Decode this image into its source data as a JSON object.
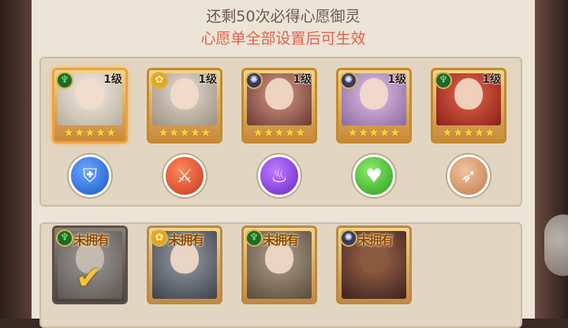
{
  "header": {
    "line1": "还剩50次必得心愿御灵",
    "line2": "心愿单全部设置后可生效"
  },
  "wishlist": [
    {
      "level": "1级",
      "element": "dragon-icon",
      "stars": "★★★★★",
      "portrait": "white",
      "selected": true
    },
    {
      "level": "1级",
      "element": "sun-icon",
      "stars": "★★★★★",
      "portrait": "grey"
    },
    {
      "level": "1级",
      "element": "web-icon",
      "stars": "★★★★★",
      "portrait": "pink"
    },
    {
      "level": "1级",
      "element": "web-icon",
      "stars": "★★★★★",
      "portrait": "lilac"
    },
    {
      "level": "1级",
      "element": "dragon-icon",
      "stars": "★★★★★",
      "portrait": "red"
    }
  ],
  "roles": [
    {
      "icon": "shield-icon",
      "glyph": "⛨",
      "color": "#1b56c8"
    },
    {
      "icon": "sword-icon",
      "glyph": "⚔",
      "color": "#c8361e"
    },
    {
      "icon": "fire-icon",
      "glyph": "♨",
      "color": "#6a26c8"
    },
    {
      "icon": "heal-icon",
      "glyph": "♥",
      "color": "#2b9a1e"
    },
    {
      "icon": "arrow-icon",
      "glyph": "➶",
      "color": "#c07a4a"
    }
  ],
  "candidates": [
    {
      "status": "未拥有",
      "element": "dragon-icon",
      "portrait": "gray2",
      "checked": true
    },
    {
      "status": "未拥有",
      "element": "sun-icon",
      "portrait": "dark"
    },
    {
      "status": "未拥有",
      "element": "dragon-icon",
      "portrait": "brown"
    },
    {
      "status": "未拥有",
      "element": "web-icon",
      "portrait": "bull"
    }
  ],
  "colors": {
    "accent_red": "#e0634c",
    "panel": "#ece4d6",
    "card_gold": "#c58a2c"
  }
}
